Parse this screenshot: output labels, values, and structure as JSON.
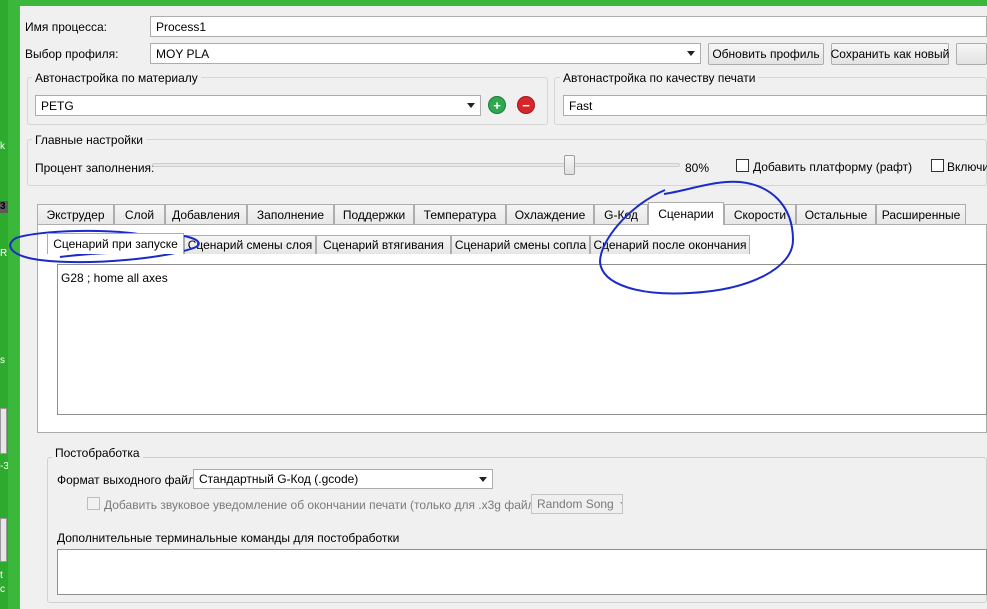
{
  "process": {
    "label": "Имя процесса:",
    "value": "Process1"
  },
  "profile": {
    "label": "Выбор профиля:",
    "value": "MOY PLA",
    "update_button": "Обновить профиль",
    "save_as_button": "Сохранить как новый"
  },
  "material_group": {
    "title": "Автонастройка по материалу",
    "value": "PETG"
  },
  "quality_group": {
    "title": "Автонастройка по качеству печати",
    "value": "Fast"
  },
  "main_settings": {
    "title": "Главные настройки",
    "infill_label": "Процент заполнения:",
    "infill_percent": 80,
    "infill_display": "80%",
    "raft_label": "Добавить платформу (рафт)",
    "supports_label": "Включи"
  },
  "tabs": [
    {
      "label": "Экструдер"
    },
    {
      "label": "Слой"
    },
    {
      "label": "Добавления"
    },
    {
      "label": "Заполнение"
    },
    {
      "label": "Поддержки"
    },
    {
      "label": "Температура"
    },
    {
      "label": "Охлаждение"
    },
    {
      "label": "G-Код"
    },
    {
      "label": "Сценарии",
      "active": true
    },
    {
      "label": "Скорости"
    },
    {
      "label": "Остальные"
    },
    {
      "label": "Расширенные"
    }
  ],
  "subtabs": [
    {
      "label": "Сценарий при запуске",
      "active": true
    },
    {
      "label": "Сценарий смены слоя"
    },
    {
      "label": "Сценарий втягивания"
    },
    {
      "label": "Сценарий смены сопла"
    },
    {
      "label": "Сценарий после окончания"
    }
  ],
  "script_content": "G28 ; home all axes",
  "postprocessing": {
    "title": "Постобработка",
    "format_label": "Формат выходного файла",
    "format_value": "Стандартный G-Код (.gcode)",
    "sound_label": "Добавить звуковое уведомление об окончании печати (только для .x3g файлов)",
    "song_value": "Random Song",
    "terminal_label": "Дополнительные терминальные команды для постобработки"
  },
  "desktop_fragments": [
    "k",
    "3",
    "R",
    "s",
    "-3",
    "t",
    "c"
  ],
  "colors": {
    "accent_green": "#3bb83b",
    "add_button": "#2fa84f",
    "remove_button": "#d9262c",
    "annotation_ink": "#1a2bc8"
  },
  "icons": [
    "add-icon",
    "remove-icon",
    "dropdown-arrow-icon"
  ]
}
